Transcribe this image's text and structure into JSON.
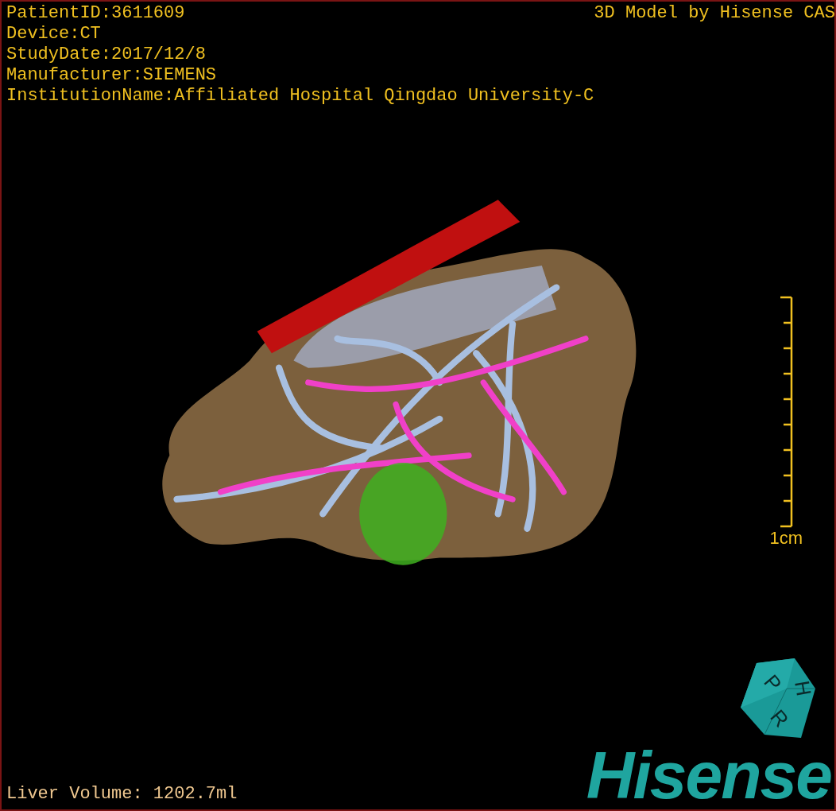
{
  "patient_info": [
    "PatientID:3611609",
    "Device:CT",
    "StudyDate:2017/12/8",
    "Manufacturer:SIEMENS",
    "InstitutionName:Affiliated Hospital Qingdao University-C"
  ],
  "title": "3D Model by Hisense CAS",
  "scale_bar": {
    "label": "1cm"
  },
  "orientation_cube": {
    "labels": [
      "P",
      "R",
      "H"
    ]
  },
  "liver_volume": "Liver Volume: 1202.7ml",
  "logo": "Hisense"
}
